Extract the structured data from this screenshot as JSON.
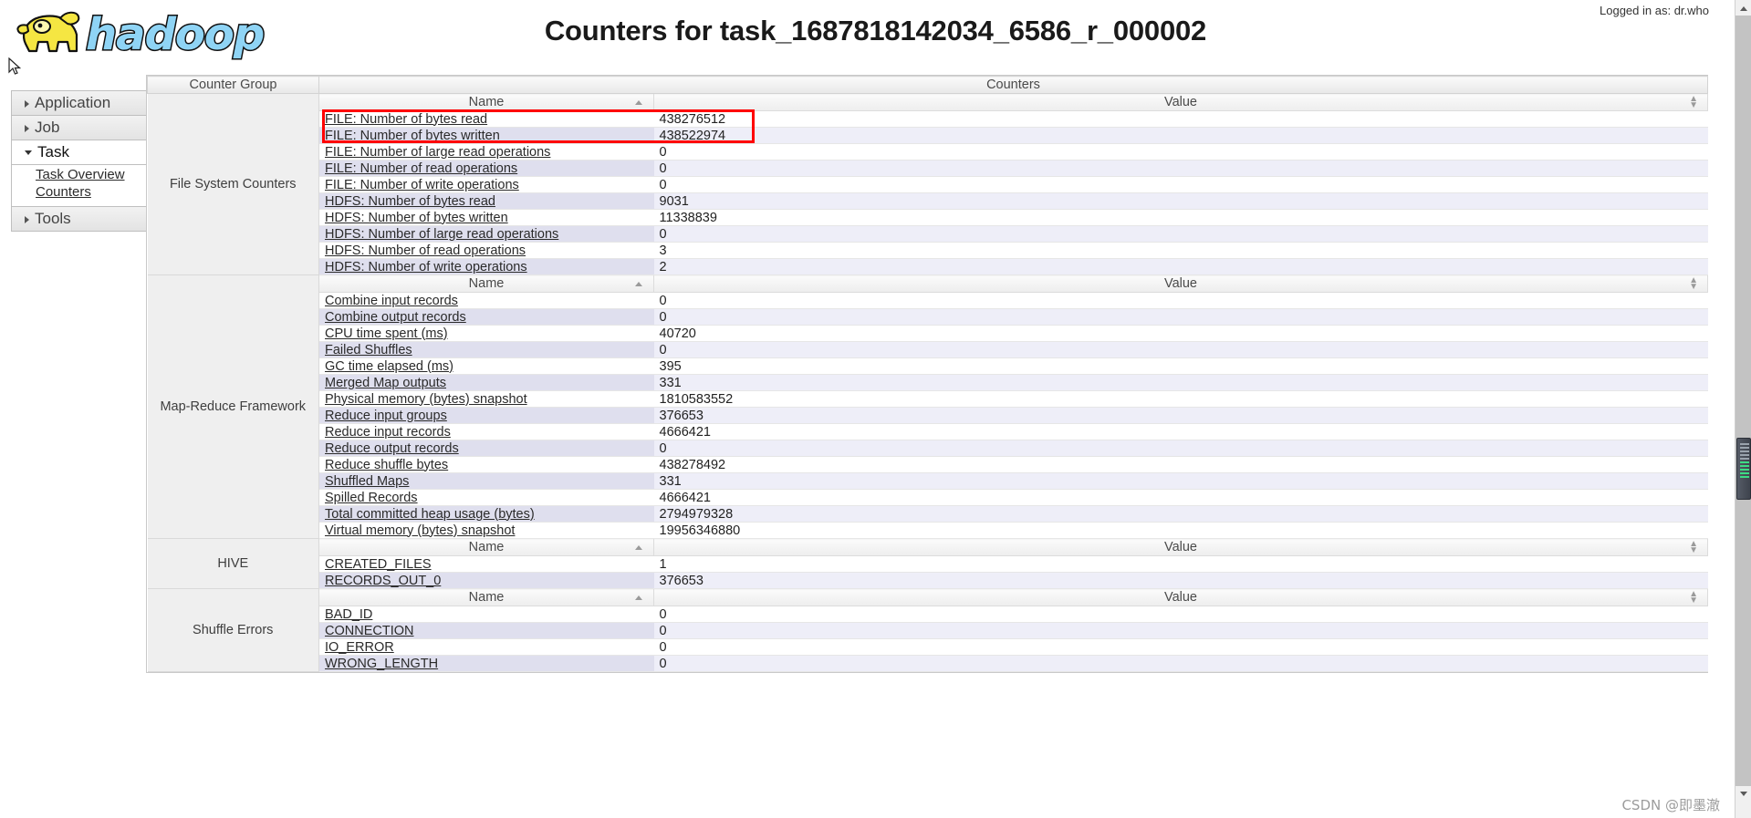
{
  "header": {
    "logo_text": "hadoop",
    "title": "Counters for task_1687818142034_6586_r_000002",
    "logged_in": "Logged in as: dr.who"
  },
  "sidebar": {
    "items": [
      {
        "label": "Application",
        "expanded": false,
        "icon": "chevron-right-icon"
      },
      {
        "label": "Job",
        "expanded": false,
        "icon": "chevron-right-icon"
      },
      {
        "label": "Task",
        "expanded": true,
        "icon": "chevron-down-icon"
      },
      {
        "label": "Tools",
        "expanded": false,
        "icon": "chevron-right-icon"
      }
    ],
    "task_children": [
      {
        "label": "Task Overview"
      },
      {
        "label": "Counters"
      }
    ]
  },
  "table": {
    "head_counter_group": "Counter Group",
    "head_counters": "Counters",
    "col_name": "Name",
    "col_value": "Value",
    "groups": [
      {
        "group": "File System Counters",
        "rows": [
          {
            "name": "FILE: Number of bytes read",
            "value": "438276512"
          },
          {
            "name": "FILE: Number of bytes written",
            "value": "438522974"
          },
          {
            "name": "FILE: Number of large read operations",
            "value": "0"
          },
          {
            "name": "FILE: Number of read operations",
            "value": "0"
          },
          {
            "name": "FILE: Number of write operations",
            "value": "0"
          },
          {
            "name": "HDFS: Number of bytes read",
            "value": "9031"
          },
          {
            "name": "HDFS: Number of bytes written",
            "value": "11338839"
          },
          {
            "name": "HDFS: Number of large read operations",
            "value": "0"
          },
          {
            "name": "HDFS: Number of read operations",
            "value": "3"
          },
          {
            "name": "HDFS: Number of write operations",
            "value": "2"
          }
        ]
      },
      {
        "group": "Map-Reduce Framework",
        "rows": [
          {
            "name": "Combine input records",
            "value": "0"
          },
          {
            "name": "Combine output records",
            "value": "0"
          },
          {
            "name": "CPU time spent (ms)",
            "value": "40720"
          },
          {
            "name": "Failed Shuffles",
            "value": "0"
          },
          {
            "name": "GC time elapsed (ms)",
            "value": "395"
          },
          {
            "name": "Merged Map outputs",
            "value": "331"
          },
          {
            "name": "Physical memory (bytes) snapshot",
            "value": "1810583552"
          },
          {
            "name": "Reduce input groups",
            "value": "376653"
          },
          {
            "name": "Reduce input records",
            "value": "4666421"
          },
          {
            "name": "Reduce output records",
            "value": "0"
          },
          {
            "name": "Reduce shuffle bytes",
            "value": "438278492"
          },
          {
            "name": "Shuffled Maps",
            "value": "331"
          },
          {
            "name": "Spilled Records",
            "value": "4666421"
          },
          {
            "name": "Total committed heap usage (bytes)",
            "value": "2794979328"
          },
          {
            "name": "Virtual memory (bytes) snapshot",
            "value": "19956346880"
          }
        ]
      },
      {
        "group": "HIVE",
        "rows": [
          {
            "name": "CREATED_FILES",
            "value": "1"
          },
          {
            "name": "RECORDS_OUT_0",
            "value": "376653"
          }
        ]
      },
      {
        "group": "Shuffle Errors",
        "rows": [
          {
            "name": "BAD_ID",
            "value": "0"
          },
          {
            "name": "CONNECTION",
            "value": "0"
          },
          {
            "name": "IO_ERROR",
            "value": "0"
          },
          {
            "name": "WRONG_LENGTH",
            "value": "0"
          }
        ]
      }
    ]
  },
  "annotation": {
    "highlight_color": "#ff0000",
    "highlight_rows": [
      "FILE: Number of bytes read",
      "FILE: Number of bytes written"
    ]
  },
  "watermark": "CSDN @即墨澈"
}
